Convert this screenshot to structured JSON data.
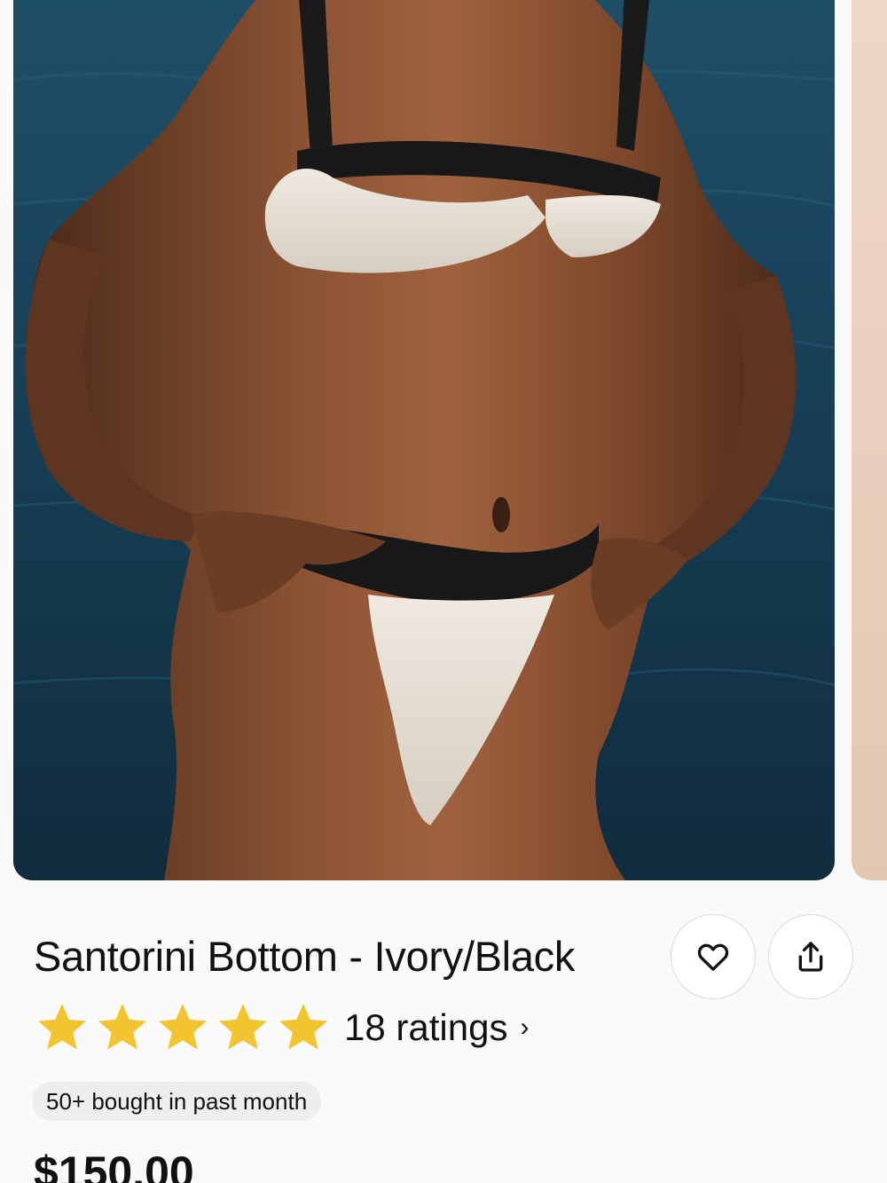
{
  "product": {
    "title": "Santorini Bottom - Ivory/Black",
    "rating": {
      "stars": 5,
      "count_label": "18 ratings",
      "chevron": "›"
    },
    "badge": "50+ bought in past month",
    "price": "$150.00"
  },
  "actions": {
    "favorite_icon": "heart-icon",
    "share_icon": "share-icon"
  },
  "colors": {
    "star": "#F2C530",
    "background": "#FAFAFA",
    "badge_bg": "#EEEEEE"
  },
  "gallery": {
    "main_image": "model in ivory and black bikini by the sea",
    "next_image": "peek of next product image"
  }
}
